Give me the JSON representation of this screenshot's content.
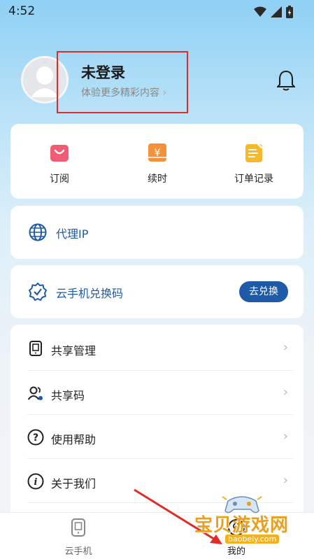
{
  "status": {
    "time": "4:52"
  },
  "profile": {
    "title": "未登录",
    "subtitle": "体验更多精彩内容"
  },
  "quick_actions": [
    {
      "label": "订阅",
      "icon": "shopping-bag-icon"
    },
    {
      "label": "续时",
      "icon": "yen-coupon-icon"
    },
    {
      "label": "订单记录",
      "icon": "order-record-icon"
    }
  ],
  "proxy": {
    "label": "代理IP",
    "icon": "globe-icon"
  },
  "redeem": {
    "label": "云手机兑换码",
    "button": "去兑换",
    "icon": "verified-badge-icon"
  },
  "menu": [
    {
      "label": "共享管理",
      "icon": "phone-share-icon"
    },
    {
      "label": "共享码",
      "icon": "users-icon"
    },
    {
      "label": "使用帮助",
      "icon": "help-circle-icon"
    },
    {
      "label": "关于我们",
      "icon": "info-circle-icon"
    }
  ],
  "tabs": [
    {
      "label": "云手机",
      "icon": "cloud-phone-icon"
    },
    {
      "label": "我的",
      "icon": "profile-icon"
    }
  ],
  "watermark": {
    "title": "宝贝游戏网",
    "url": "baobeiy.com"
  },
  "colors": {
    "accent": "#1e5aa8",
    "highlight": "#e02b2b"
  }
}
